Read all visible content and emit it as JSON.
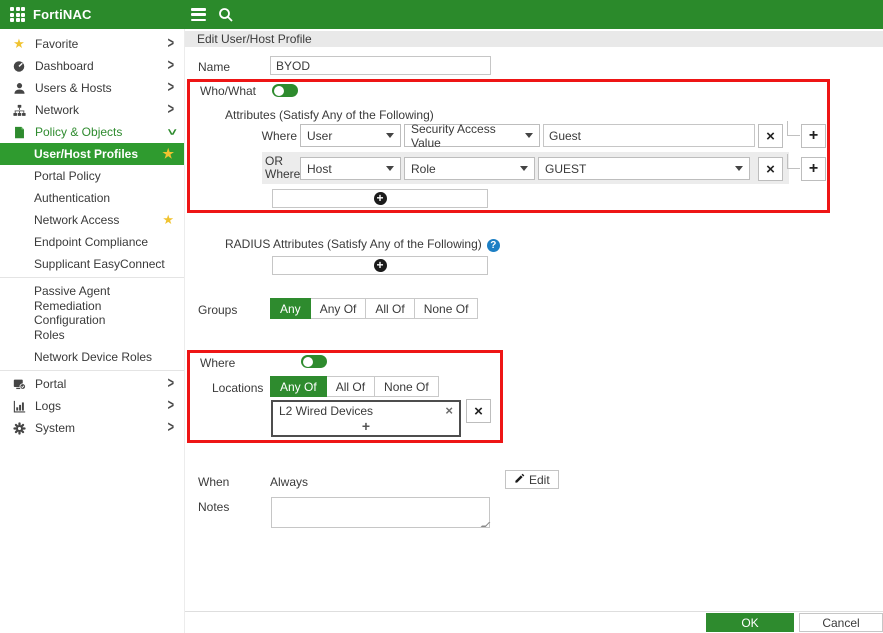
{
  "topbar": {
    "brand": "FortiNAC"
  },
  "sidebar": {
    "items": [
      {
        "label": "Favorite",
        "icon": "star-icon"
      },
      {
        "label": "Dashboard",
        "icon": "gauge-icon"
      },
      {
        "label": "Users & Hosts",
        "icon": "user-icon"
      },
      {
        "label": "Network",
        "icon": "sitemap-icon"
      },
      {
        "label": "Policy & Objects",
        "icon": "policy-icon",
        "expanded": true
      }
    ],
    "submenu": [
      {
        "label": "User/Host Profiles",
        "selected": true,
        "starred": true
      },
      {
        "label": "Portal Policy"
      },
      {
        "label": "Authentication"
      },
      {
        "label": "Network Access",
        "starred": true
      },
      {
        "label": "Endpoint Compliance"
      },
      {
        "label": "Supplicant EasyConnect"
      },
      {
        "label": "Passive Agent"
      },
      {
        "label": "Remediation Configuration"
      },
      {
        "label": "Roles"
      },
      {
        "label": "Network Device Roles"
      }
    ],
    "bottom_items": [
      {
        "label": "Portal",
        "icon": "portal-icon"
      },
      {
        "label": "Logs",
        "icon": "logs-icon"
      },
      {
        "label": "System",
        "icon": "gear-icon"
      }
    ]
  },
  "main": {
    "title": "Edit User/Host Profile",
    "name_label": "Name",
    "name_value": "BYOD",
    "who_what": {
      "label": "Who/What",
      "enabled": true,
      "attributes_label": "Attributes (Satisfy Any of the Following)",
      "rows": [
        {
          "prefix": "Where",
          "category": "User",
          "attribute": "Security Access Value",
          "value": "Guest",
          "value_type": "text"
        },
        {
          "prefix_line1": "OR",
          "prefix_line2": "Where",
          "category": "Host",
          "attribute": "Role",
          "value": "GUEST",
          "value_type": "dropdown"
        }
      ]
    },
    "radius_label": "RADIUS Attributes (Satisfy Any of the Following)",
    "groups": {
      "label": "Groups",
      "options": [
        "Any",
        "Any Of",
        "All Of",
        "None Of"
      ],
      "selected": "Any"
    },
    "where": {
      "label": "Where",
      "enabled": true,
      "locations_label": "Locations",
      "options": [
        "Any Of",
        "All Of",
        "None Of"
      ],
      "selected": "Any Of",
      "locations": [
        "L2 Wired Devices"
      ]
    },
    "when": {
      "label": "When",
      "value": "Always",
      "edit_label": "Edit"
    },
    "notes": {
      "label": "Notes",
      "value": ""
    },
    "footer": {
      "ok_label": "OK",
      "cancel_label": "Cancel"
    }
  },
  "colors": {
    "topbar_green": "#2b8a2b",
    "accent_green": "#2e8b2e",
    "selected_green": "#2f9b2f",
    "annotation_red": "#ee1515",
    "star_yellow": "#f0c330",
    "header_bar_bg": "#e9e9e9"
  }
}
